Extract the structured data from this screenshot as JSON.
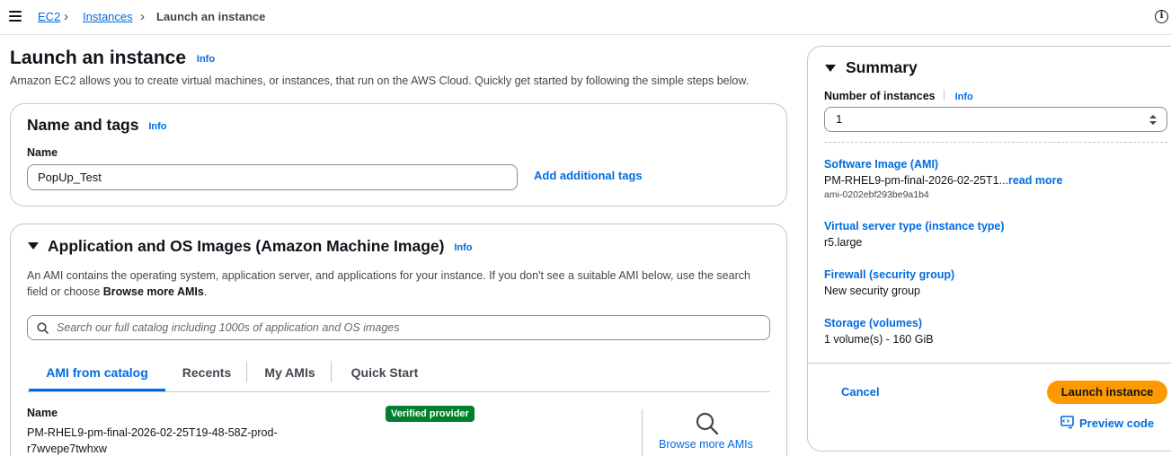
{
  "breadcrumb": {
    "items": [
      "EC2",
      "Instances",
      "Launch an instance"
    ]
  },
  "page": {
    "title": "Launch an instance",
    "info": "Info",
    "description": "Amazon EC2 allows you to create virtual machines, or instances, that run on the AWS Cloud. Quickly get started by following the simple steps below."
  },
  "name_tags": {
    "title": "Name and tags",
    "info": "Info",
    "name_label": "Name",
    "name_value": "PopUp_Test",
    "add_tags": "Add additional tags"
  },
  "ami": {
    "title": "Application and OS Images (Amazon Machine Image)",
    "info": "Info",
    "desc_part1": "An AMI contains the operating system, application server, and applications for your instance. If you don't see a suitable AMI below, use the search field or choose ",
    "desc_bold": "Browse more AMIs",
    "desc_end": ".",
    "search_placeholder": "Search our full catalog including 1000s of application and OS images",
    "tabs": [
      "AMI from catalog",
      "Recents",
      "My AMIs",
      "Quick Start"
    ],
    "active_tab": "AMI from catalog",
    "name_label": "Name",
    "name_line1": "PM-RHEL9-pm-final-2026-02-25T19-48-58Z-prod-",
    "name_line2": "r7wvepe7twhxw",
    "badge": "Verified provider",
    "browse_more": "Browse more AMIs"
  },
  "summary": {
    "title": "Summary",
    "num_instances_label": "Number of instances",
    "info": "Info",
    "num_instances_value": "1",
    "software_image_label": "Software Image (AMI)",
    "software_image_value": "PM-RHEL9-pm-final-2026-02-25T1...",
    "read_more": "read more",
    "ami_id": "ami-0202ebf293be9a1b4",
    "instance_type_label": "Virtual server type (instance type)",
    "instance_type_value": "r5.large",
    "firewall_label": "Firewall (security group)",
    "firewall_value": "New security group",
    "storage_label": "Storage (volumes)",
    "storage_value": "1 volume(s) - 160 GiB",
    "cancel": "Cancel",
    "launch": "Launch instance",
    "preview_code": "Preview code"
  },
  "colors": {
    "link": "#006ce0",
    "primary_button": "#ff9900",
    "badge": "#00802f",
    "border": "#c6c6cd"
  },
  "icons": [
    "menu-icon",
    "chevron-right-icon",
    "info-circle-icon",
    "caret-down-icon",
    "search-icon",
    "stepper-icon",
    "code-icon"
  ]
}
